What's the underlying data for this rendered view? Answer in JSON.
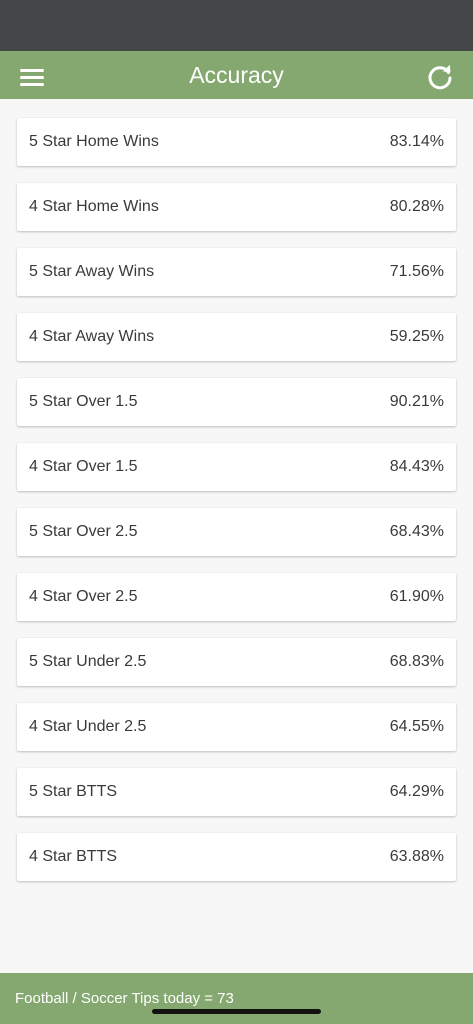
{
  "header": {
    "title": "Accuracy",
    "menu_icon": "hamburger-menu-icon",
    "refresh_icon": "refresh-icon"
  },
  "accuracy_list": [
    {
      "label": "5 Star Home Wins",
      "value": "83.14%"
    },
    {
      "label": "4 Star Home Wins",
      "value": "80.28%"
    },
    {
      "label": "5 Star Away Wins",
      "value": "71.56%"
    },
    {
      "label": "4 Star Away Wins",
      "value": "59.25%"
    },
    {
      "label": "5 Star Over 1.5",
      "value": "90.21%"
    },
    {
      "label": "4 Star Over 1.5",
      "value": "84.43%"
    },
    {
      "label": "5 Star Over 2.5",
      "value": "68.43%"
    },
    {
      "label": "4 Star Over 2.5",
      "value": "61.90%"
    },
    {
      "label": "5 Star Under 2.5",
      "value": "68.83%"
    },
    {
      "label": "4 Star Under 2.5",
      "value": "64.55%"
    },
    {
      "label": "5 Star BTTS",
      "value": "64.29%"
    },
    {
      "label": "4 Star BTTS",
      "value": "63.88%"
    }
  ],
  "footer": {
    "text": "Football / Soccer Tips today = 73"
  },
  "colors": {
    "accent": "#84a870",
    "status_bar": "#454648",
    "background": "#f7f7f7"
  }
}
